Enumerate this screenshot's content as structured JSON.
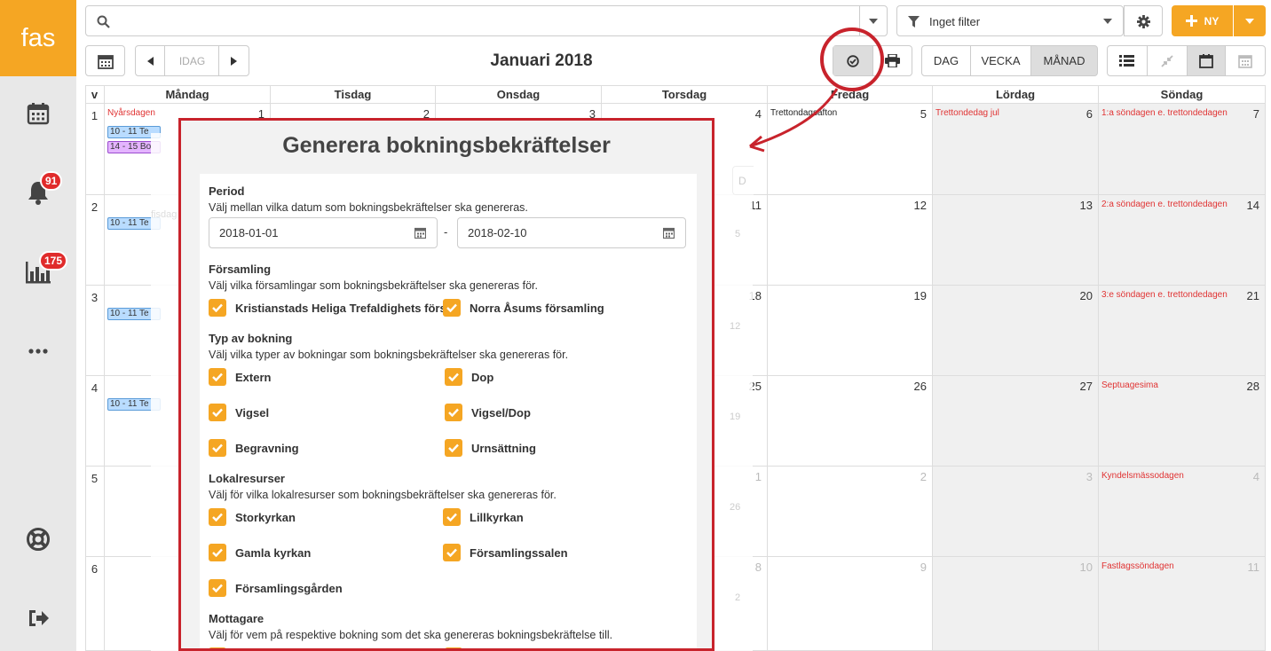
{
  "app": {
    "logo": "fas"
  },
  "sidebar": {
    "items": [
      {
        "icon": "calendar-icon"
      },
      {
        "icon": "bell-icon",
        "badge": "91"
      },
      {
        "icon": "bar-chart-icon",
        "badge": "175"
      },
      {
        "icon": "more-icon"
      },
      {
        "icon": "lifebuoy-icon"
      },
      {
        "icon": "logout-icon"
      }
    ]
  },
  "topbar": {
    "search_placeholder": "",
    "filter_label": "Inget filter",
    "new_label": "NY"
  },
  "toolbar": {
    "today_label": "IDAG",
    "title": "Januari 2018",
    "views": [
      "DAG",
      "VECKA",
      "MÅNAD"
    ],
    "active_view": "MÅNAD"
  },
  "calendar": {
    "week_header": "v",
    "weekdays": [
      "Måndag",
      "Tisdag",
      "Onsdag",
      "Torsdag",
      "Fredag",
      "Lördag",
      "Söndag"
    ],
    "weeks": [
      "1",
      "2",
      "3",
      "4",
      "5",
      "6"
    ],
    "days": [
      {
        "fri": "5",
        "sat": "6",
        "sun": "7",
        "thu": "4",
        "wed": "3",
        "tue": "2",
        "mon": "1"
      },
      {
        "thu": "11",
        "fri": "12",
        "sat": "13",
        "sun": "14"
      },
      {
        "thu": "18",
        "fri": "19",
        "sat": "20",
        "sun": "21"
      },
      {
        "thu": "25",
        "fri": "26",
        "sat": "27",
        "sun": "28"
      },
      {
        "thu": "1",
        "fri": "2",
        "sat": "3",
        "sun": "4"
      },
      {
        "thu": "8",
        "fri": "9",
        "sat": "10",
        "sun": "11"
      }
    ],
    "holidays": {
      "w1_mon": "Nyårsdagen",
      "w1_fri": "Trettondagsafton",
      "w1_sat": "Trettondedag jul",
      "w1_sun": "1:a söndagen e. trettondedagen",
      "w2_sun": "2:a söndagen e. trettondedagen",
      "w3_sun": "3:e söndagen e. trettondedagen",
      "w4_sun": "Septuagesima",
      "w5_sun": "Kyndelsmässodagen",
      "w6_sun": "Fastlagssöndagen"
    },
    "events": {
      "e1": "10 - 11 Te",
      "e2": "14 - 15 Bo",
      "e3": "10 - 11 Te",
      "e4": "10 - 11 Te",
      "e5": "10 - 11 Te"
    },
    "ghost": {
      "g1": "D",
      "g2": "5",
      "g3": "12",
      "g4": "19",
      "g5": "26",
      "g6": "2",
      "g7": "fisdag"
    }
  },
  "modal": {
    "title": "Generera bokningsbekräftelser",
    "period": {
      "heading": "Period",
      "desc": "Välj mellan vilka datum som bokningsbekräftelser ska genereras.",
      "from": "2018-01-01",
      "separator": "-",
      "to": "2018-02-10"
    },
    "parish": {
      "heading": "Församling",
      "desc": "Välj vilka församlingar som bokningsbekräftelser ska genereras för.",
      "options": [
        "Kristianstads Heliga Trefaldighets församling",
        "Norra Åsums församling"
      ]
    },
    "booking_type": {
      "heading": "Typ av bokning",
      "desc": "Välj vilka typer av bokningar som bokningsbekräftelser ska genereras för.",
      "options": [
        "Extern",
        "Dop",
        "Vigsel",
        "Vigsel/Dop",
        "Begravning",
        "Urnsättning"
      ]
    },
    "resources": {
      "heading": "Lokalresurser",
      "desc": "Välj för vilka lokalresurser som bokningsbekräftelser ska genereras för.",
      "options": [
        "Storkyrkan",
        "Lillkyrkan",
        "Gamla kyrkan",
        "Församlingssalen",
        "Församlingsgården"
      ]
    },
    "recipient": {
      "heading": "Mottagare",
      "desc": "Välj för vem på respektive bokning som det ska genereras bokningsbekräftelse till."
    }
  },
  "colors": {
    "accent": "#f5a623",
    "annotation": "#c8232c",
    "badge": "#e02b2b",
    "holiday": "#e03333"
  }
}
